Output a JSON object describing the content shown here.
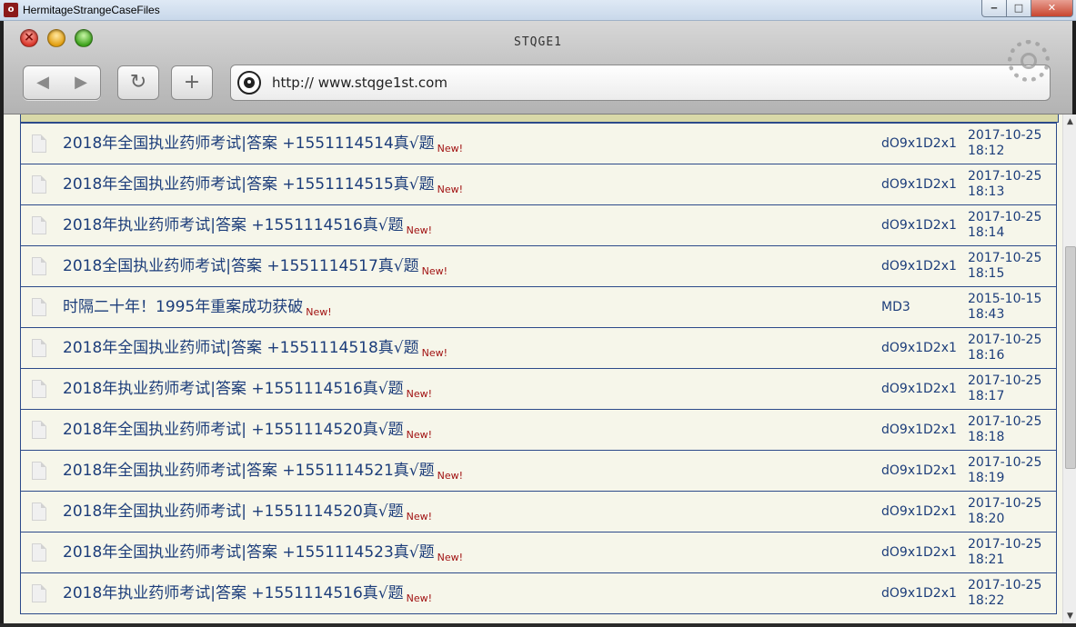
{
  "os_window": {
    "title": "HermitageStrangeCaseFiles",
    "app_icon": "o",
    "min_symbol": "‒",
    "max_symbol": "□",
    "close_symbol": "✕"
  },
  "browser": {
    "window_title": "STQGE1",
    "back_symbol": "◀",
    "forward_symbol": "▶",
    "reload_symbol": "↻",
    "add_symbol": "+",
    "url": "http:// www.stqge1st.com"
  },
  "new_label": "New!",
  "rows": [
    {
      "title": "2018年全国执业药师考试|答案 +1551114514真√题",
      "author": "dO9x1D2x1",
      "date": "2017-10-25",
      "time": "18:12"
    },
    {
      "title": "2018年全国执业药师考试|答案 +1551114515真√题",
      "author": "dO9x1D2x1",
      "date": "2017-10-25",
      "time": "18:13"
    },
    {
      "title": "2018年执业药师考试|答案 +1551114516真√题",
      "author": "dO9x1D2x1",
      "date": "2017-10-25",
      "time": "18:14"
    },
    {
      "title": "2018全国执业药师考试|答案 +1551114517真√题",
      "author": "dO9x1D2x1",
      "date": "2017-10-25",
      "time": "18:15"
    },
    {
      "title": "时隔二十年！1995年重案成功获破",
      "author": "MD3",
      "date": "2015-10-15",
      "time": "18:43"
    },
    {
      "title": "2018年全国执业药师试|答案 +1551114518真√题",
      "author": "dO9x1D2x1",
      "date": "2017-10-25",
      "time": "18:16"
    },
    {
      "title": "2018年执业药师考试|答案 +1551114516真√题",
      "author": "dO9x1D2x1",
      "date": "2017-10-25",
      "time": "18:17"
    },
    {
      "title": "2018年全国执业药师考试| +1551114520真√题",
      "author": "dO9x1D2x1",
      "date": "2017-10-25",
      "time": "18:18"
    },
    {
      "title": "2018年全国执业药师考试|答案 +1551114521真√题",
      "author": "dO9x1D2x1",
      "date": "2017-10-25",
      "time": "18:19"
    },
    {
      "title": "2018年全国执业药师考试| +1551114520真√题",
      "author": "dO9x1D2x1",
      "date": "2017-10-25",
      "time": "18:20"
    },
    {
      "title": "2018年全国执业药师考试|答案 +1551114523真√题",
      "author": "dO9x1D2x1",
      "date": "2017-10-25",
      "time": "18:21"
    },
    {
      "title": "2018年执业药师考试|答案 +1551114516真√题",
      "author": "dO9x1D2x1",
      "date": "2017-10-25",
      "time": "18:22"
    }
  ],
  "scrollbar": {
    "up_symbol": "▲",
    "down_symbol": "▼"
  }
}
